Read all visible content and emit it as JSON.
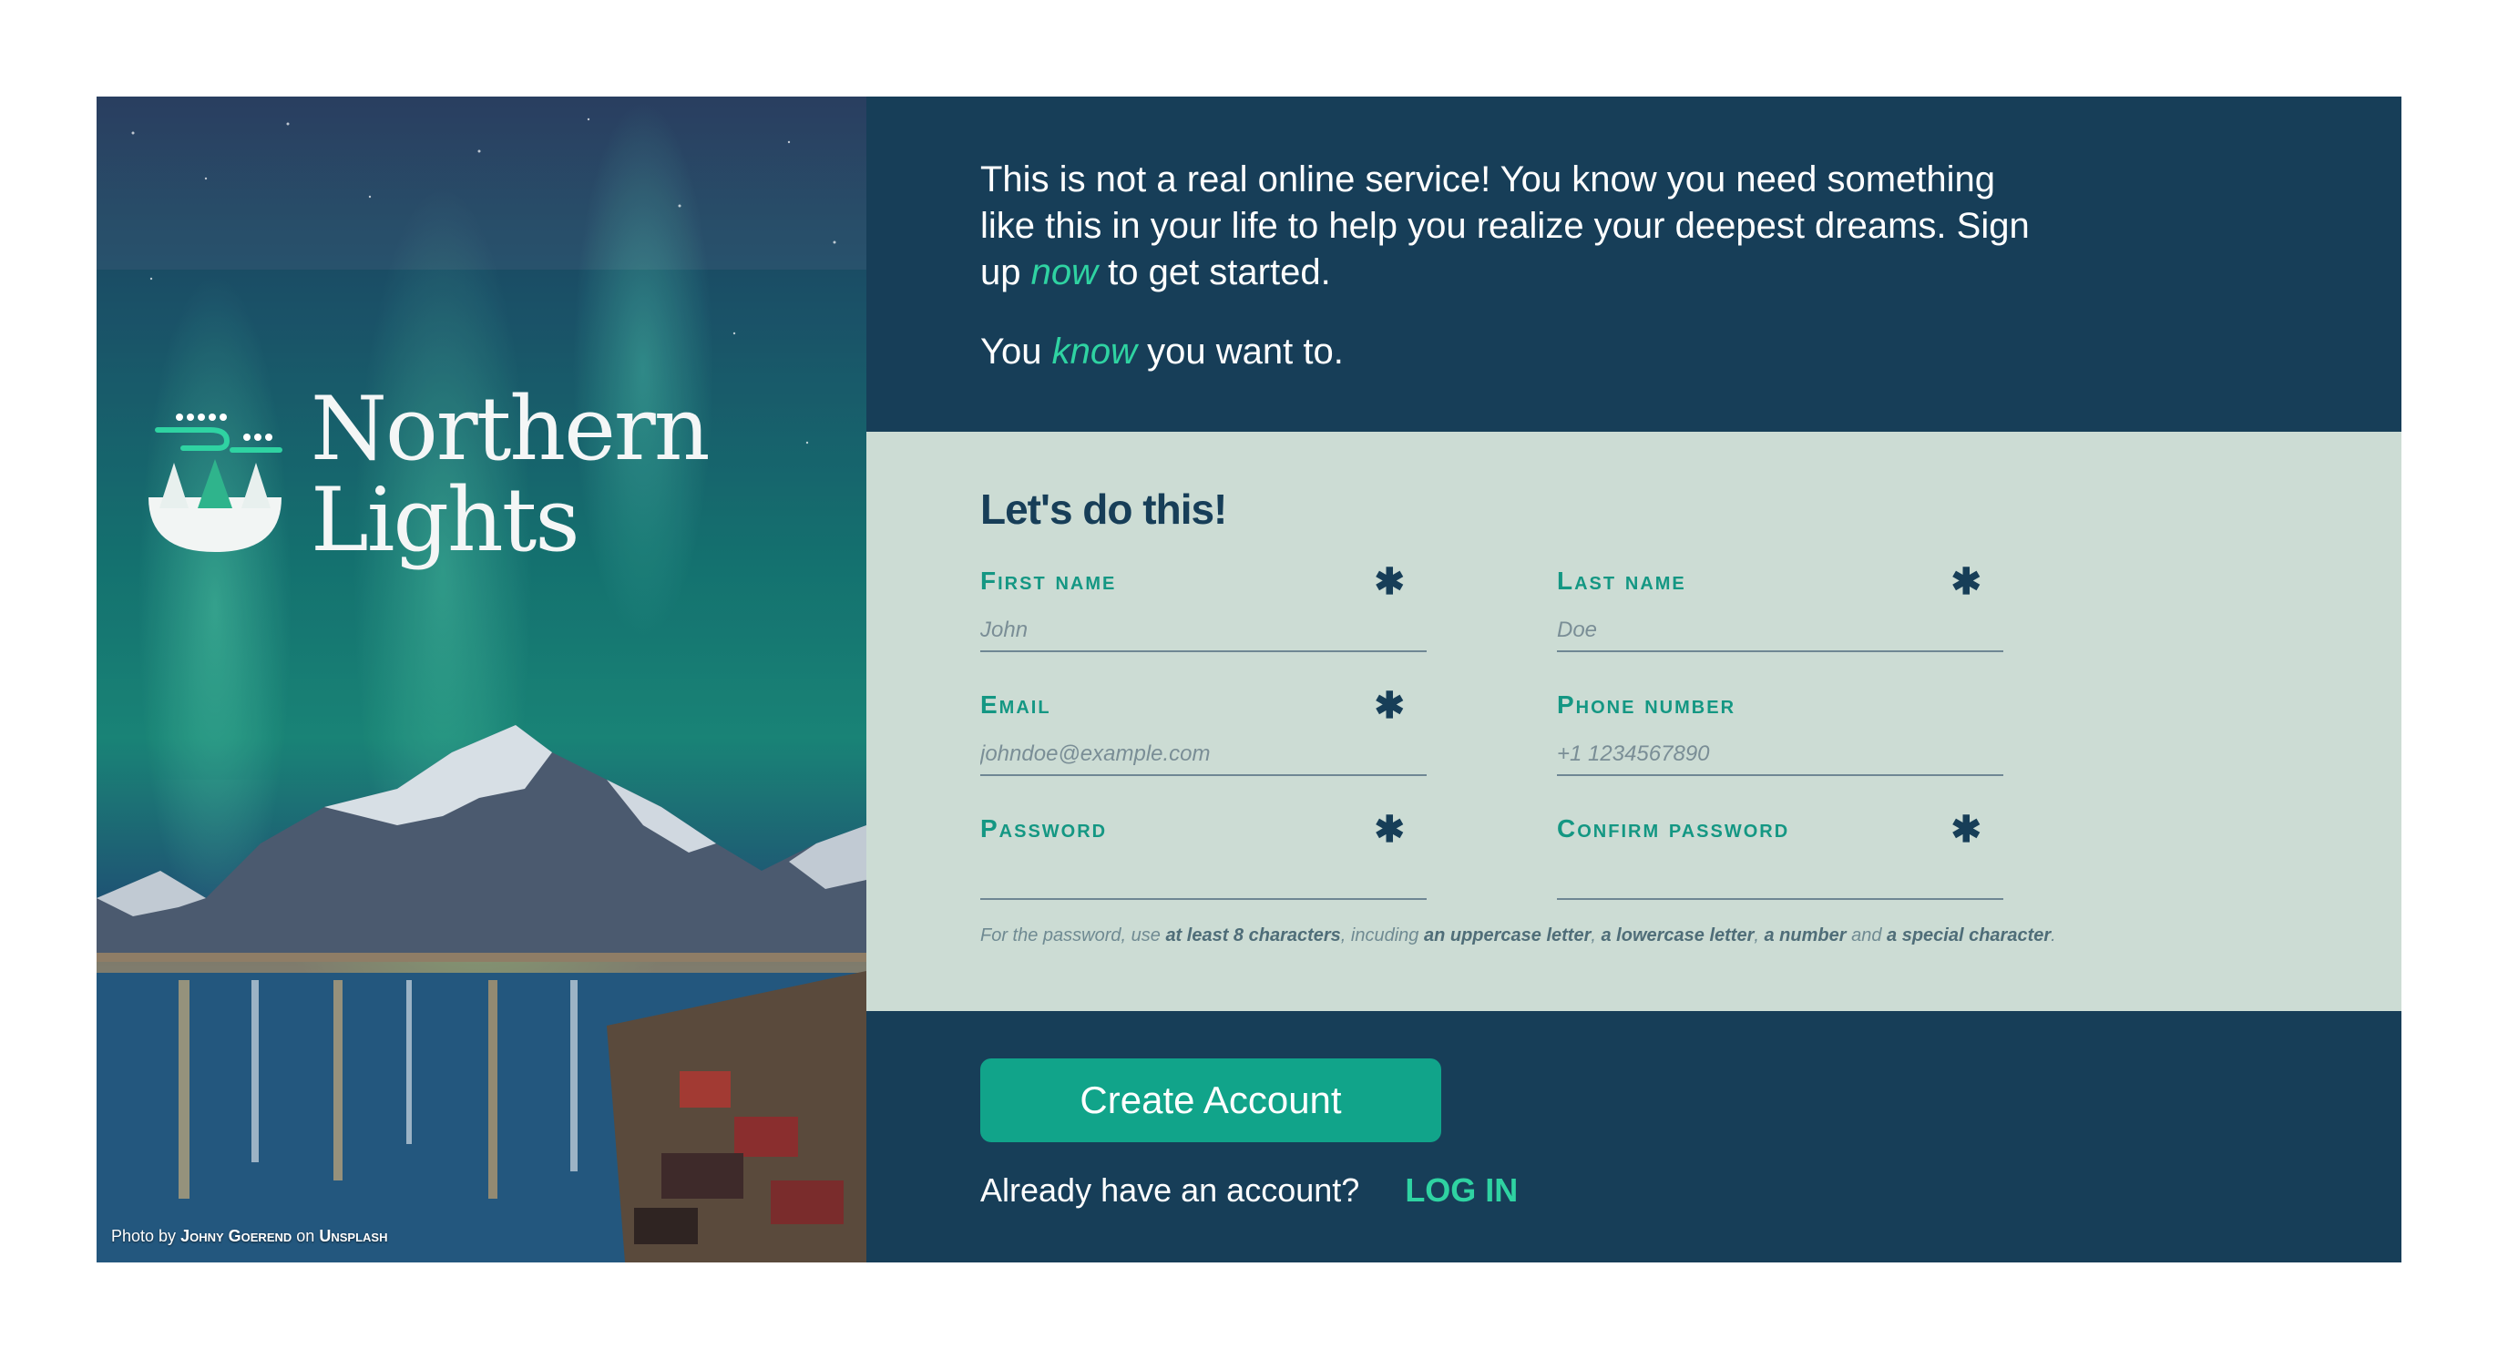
{
  "hero": {
    "brand_line1": "Northern",
    "brand_line2": "Lights",
    "credit": {
      "prefix": "Photo by",
      "author": "Johny Goerend",
      "middle": "on",
      "source": "Unsplash"
    }
  },
  "intro": {
    "line1_part1": "This is not a real online service! You know you need something like this in your life to help you realize your deepest dreams. Sign up ",
    "line1_accent": "now",
    "line1_part2": " to get started.",
    "line2_part1": "You ",
    "line2_accent": "know",
    "line2_part2": " you want to."
  },
  "form": {
    "title": "Let's do this!",
    "required_marker": "✱",
    "fields": [
      {
        "label": "First name",
        "placeholder": "John",
        "required": true
      },
      {
        "label": "Last name",
        "placeholder": "Doe",
        "required": true
      },
      {
        "label": "Email",
        "placeholder": "johndoe@example.com",
        "required": true
      },
      {
        "label": "Phone number",
        "placeholder": "+1 1234567890",
        "required": false
      },
      {
        "label": "Password",
        "placeholder": "",
        "required": true
      },
      {
        "label": "Confirm password",
        "placeholder": "",
        "required": true
      }
    ],
    "hint": {
      "t1": "For the password, use ",
      "b1": "at least 8 characters",
      "t2": ", incuding ",
      "b2": "an uppercase letter",
      "t3": ", ",
      "b3": "a lowercase letter",
      "t4": ", ",
      "b4": "a number",
      "t5": " and ",
      "b5": "a special character",
      "t6": "."
    }
  },
  "actions": {
    "create_label": "Create Account",
    "login_prompt": "Already have an account?",
    "login_label": "LOG IN"
  },
  "colors": {
    "navy": "#173e58",
    "mint_panel": "#ccdcd4",
    "teal_button": "#11a48a",
    "accent_green": "#2fd3a2",
    "label_teal": "#149783"
  }
}
